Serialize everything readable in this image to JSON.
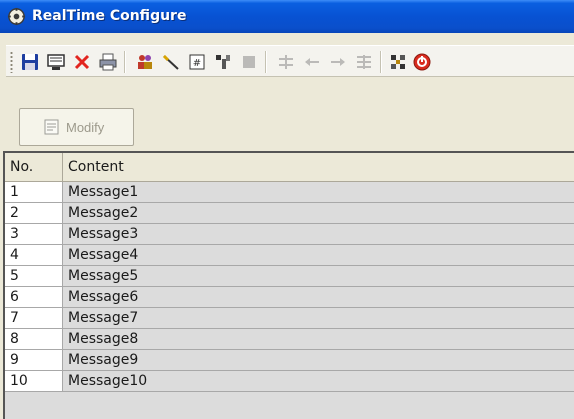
{
  "window": {
    "title": "RealTime Configure"
  },
  "toolbar": {
    "buttons": [
      {
        "icon": "save-icon"
      },
      {
        "icon": "monitor-icon"
      },
      {
        "icon": "delete-icon"
      },
      {
        "icon": "print-icon"
      },
      {
        "icon": "users-icon"
      },
      {
        "icon": "pencil-icon"
      },
      {
        "icon": "number-icon"
      },
      {
        "icon": "tools-icon"
      },
      {
        "icon": "stop-icon"
      },
      {
        "icon": "align-top-icon"
      },
      {
        "icon": "arrow-left-icon"
      },
      {
        "icon": "arrow-right-icon"
      },
      {
        "icon": "align-bottom-icon"
      },
      {
        "icon": "network-icon"
      },
      {
        "icon": "power-icon"
      }
    ]
  },
  "actions": {
    "modify_label": "Modify"
  },
  "table": {
    "headers": {
      "no": "No.",
      "content": "Content"
    },
    "rows": [
      {
        "no": "1",
        "content": "Message1"
      },
      {
        "no": "2",
        "content": "Message2"
      },
      {
        "no": "3",
        "content": "Message3"
      },
      {
        "no": "4",
        "content": "Message4"
      },
      {
        "no": "5",
        "content": "Message5"
      },
      {
        "no": "6",
        "content": "Message6"
      },
      {
        "no": "7",
        "content": "Message7"
      },
      {
        "no": "8",
        "content": "Message8"
      },
      {
        "no": "9",
        "content": "Message9"
      },
      {
        "no": "10",
        "content": "Message10"
      }
    ]
  }
}
